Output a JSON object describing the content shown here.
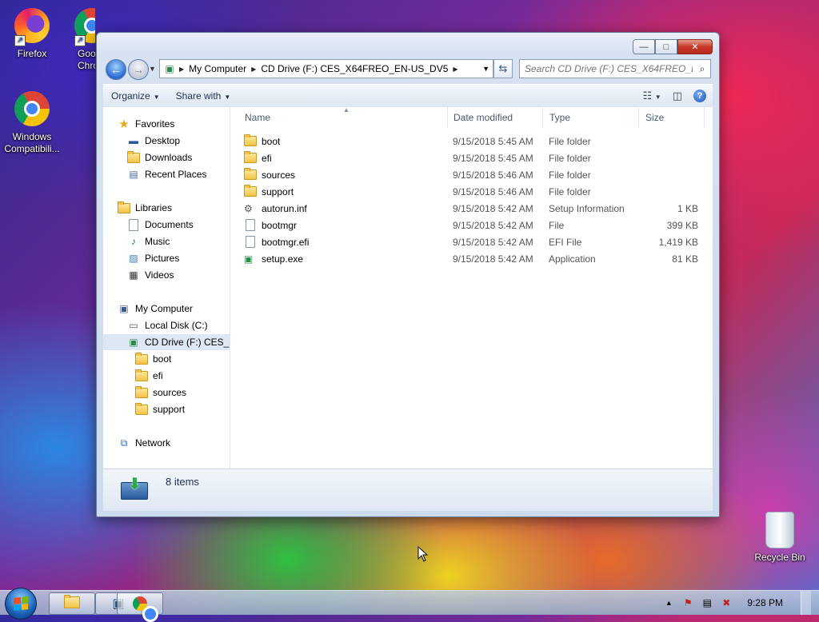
{
  "desktop": {
    "icons": [
      {
        "label": "Firefox",
        "icon": "firefox-icon"
      },
      {
        "label": "Goo Chro",
        "icon": "chrome-icon"
      },
      {
        "label": "Windows Compatibili...",
        "icon": "chrome-icon"
      },
      {
        "label": "Recycle Bin",
        "icon": "recycle-bin-icon"
      }
    ]
  },
  "window": {
    "caption": {
      "minimize": "—",
      "maximize": "□",
      "close": "✕"
    },
    "address": {
      "crumbs": [
        "My Computer",
        "CD Drive (F:) CES_X64FREO_EN-US_DV5"
      ]
    },
    "search": {
      "placeholder": "Search CD Drive (F:) CES_X64FREO_E..."
    },
    "toolbar": {
      "organize": "Organize",
      "share_with": "Share with"
    },
    "nav": {
      "favorites": "Favorites",
      "desktop": "Desktop",
      "downloads": "Downloads",
      "recent_places": "Recent Places",
      "libraries": "Libraries",
      "documents": "Documents",
      "music": "Music",
      "pictures": "Pictures",
      "videos": "Videos",
      "my_computer": "My Computer",
      "local_disk": "Local Disk (C:)",
      "cd_drive": "CD Drive (F:) CES_X6",
      "sub_boot": "boot",
      "sub_efi": "efi",
      "sub_sources": "sources",
      "sub_support": "support",
      "network": "Network"
    },
    "columns": {
      "name": "Name",
      "date": "Date modified",
      "type": "Type",
      "size": "Size"
    },
    "files": [
      {
        "name": "boot",
        "date": "9/15/2018 5:45 AM",
        "type": "File folder",
        "size": "",
        "icon": "folder-icon"
      },
      {
        "name": "efi",
        "date": "9/15/2018 5:45 AM",
        "type": "File folder",
        "size": "",
        "icon": "folder-icon"
      },
      {
        "name": "sources",
        "date": "9/15/2018 5:46 AM",
        "type": "File folder",
        "size": "",
        "icon": "folder-icon"
      },
      {
        "name": "support",
        "date": "9/15/2018 5:46 AM",
        "type": "File folder",
        "size": "",
        "icon": "folder-icon"
      },
      {
        "name": "autorun.inf",
        "date": "9/15/2018 5:42 AM",
        "type": "Setup Information",
        "size": "1 KB",
        "icon": "settings-file-icon"
      },
      {
        "name": "bootmgr",
        "date": "9/15/2018 5:42 AM",
        "type": "File",
        "size": "399 KB",
        "icon": "file-icon"
      },
      {
        "name": "bootmgr.efi",
        "date": "9/15/2018 5:42 AM",
        "type": "EFI File",
        "size": "1,419 KB",
        "icon": "file-icon"
      },
      {
        "name": "setup.exe",
        "date": "9/15/2018 5:42 AM",
        "type": "Application",
        "size": "81 KB",
        "icon": "setup-icon"
      }
    ],
    "details": {
      "item_count": "8 items"
    }
  },
  "taskbar": {
    "clock": "9:28 PM",
    "items": [
      "explorer-icon",
      "monitor-icon",
      "chrome-icon"
    ]
  },
  "colors": {
    "selection": "#dde8f4",
    "link_text": "#1e3050"
  }
}
